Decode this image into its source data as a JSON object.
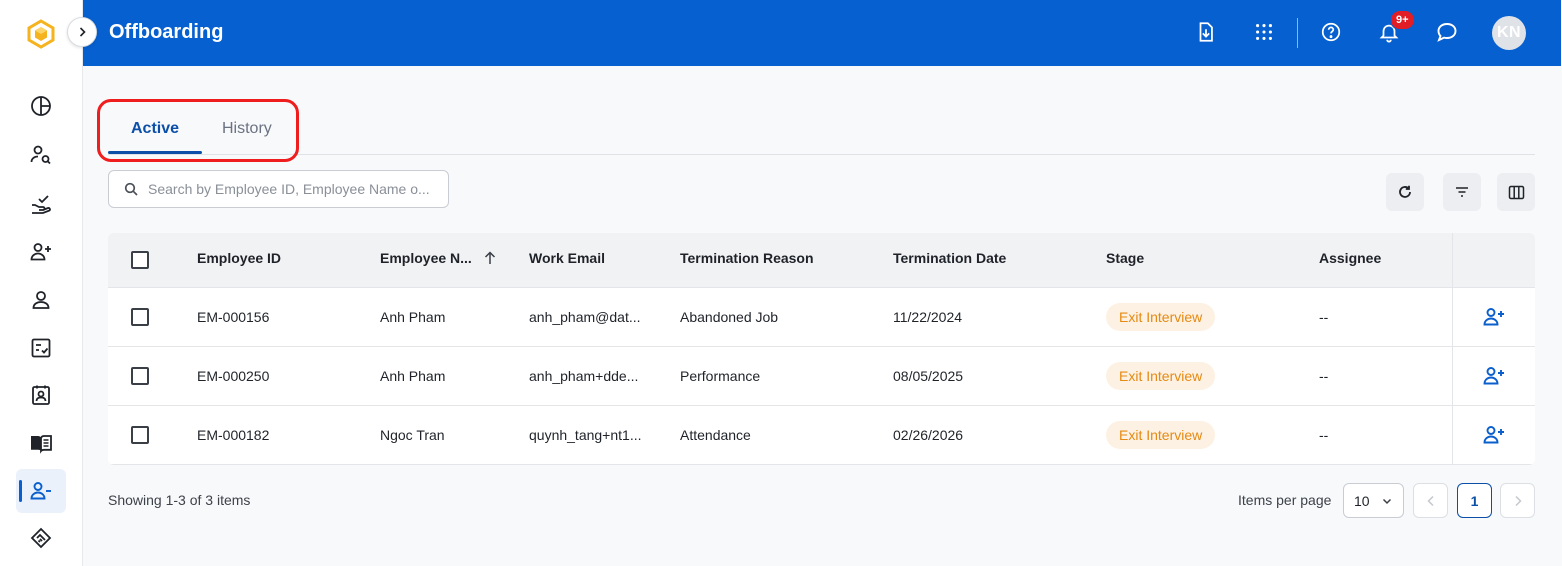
{
  "header": {
    "title": "Offboarding",
    "notification_badge": "9+",
    "avatar_initials": "KN"
  },
  "sidebar": {
    "items": [
      {
        "icon": "pie-chart-icon"
      },
      {
        "icon": "user-search-icon"
      },
      {
        "icon": "hand-check-icon"
      },
      {
        "icon": "user-add-icon"
      },
      {
        "icon": "user-icon"
      },
      {
        "icon": "checklist-icon"
      },
      {
        "icon": "id-badge-icon"
      },
      {
        "icon": "book-icon"
      },
      {
        "icon": "user-minus-icon",
        "active": true
      },
      {
        "icon": "handshake-icon"
      }
    ]
  },
  "tabs": [
    {
      "label": "Active",
      "active": true
    },
    {
      "label": "History",
      "active": false
    }
  ],
  "search": {
    "placeholder": "Search by Employee ID, Employee Name o..."
  },
  "table": {
    "columns": [
      "Employee ID",
      "Employee N...",
      "Work Email",
      "Termination Reason",
      "Termination Date",
      "Stage",
      "Assignee"
    ],
    "sorted_column": "Employee N...",
    "sort_direction": "ascending",
    "rows": [
      {
        "id": "EM-000156",
        "name": "Anh Pham",
        "email": "anh_pham@dat...",
        "reason": "Abandoned Job",
        "date": "11/22/2024",
        "stage": "Exit Interview",
        "assignee": "--"
      },
      {
        "id": "EM-000250",
        "name": "Anh Pham",
        "email": "anh_pham+dde...",
        "reason": "Performance",
        "date": "08/05/2025",
        "stage": "Exit Interview",
        "assignee": "--"
      },
      {
        "id": "EM-000182",
        "name": "Ngoc Tran",
        "email": "quynh_tang+nt1...",
        "reason": "Attendance",
        "date": "02/26/2026",
        "stage": "Exit Interview",
        "assignee": "--"
      }
    ]
  },
  "footer": {
    "showing": "Showing 1-3 of 3 items",
    "items_per_page_label": "Items per page",
    "items_per_page": "10",
    "current_page": "1"
  },
  "colors": {
    "brand": "#0760d0",
    "accent": "#0b4fa8",
    "stage_text": "#e58a12",
    "stage_bg": "#fdf1e3",
    "highlight": "#ef1d1d"
  }
}
